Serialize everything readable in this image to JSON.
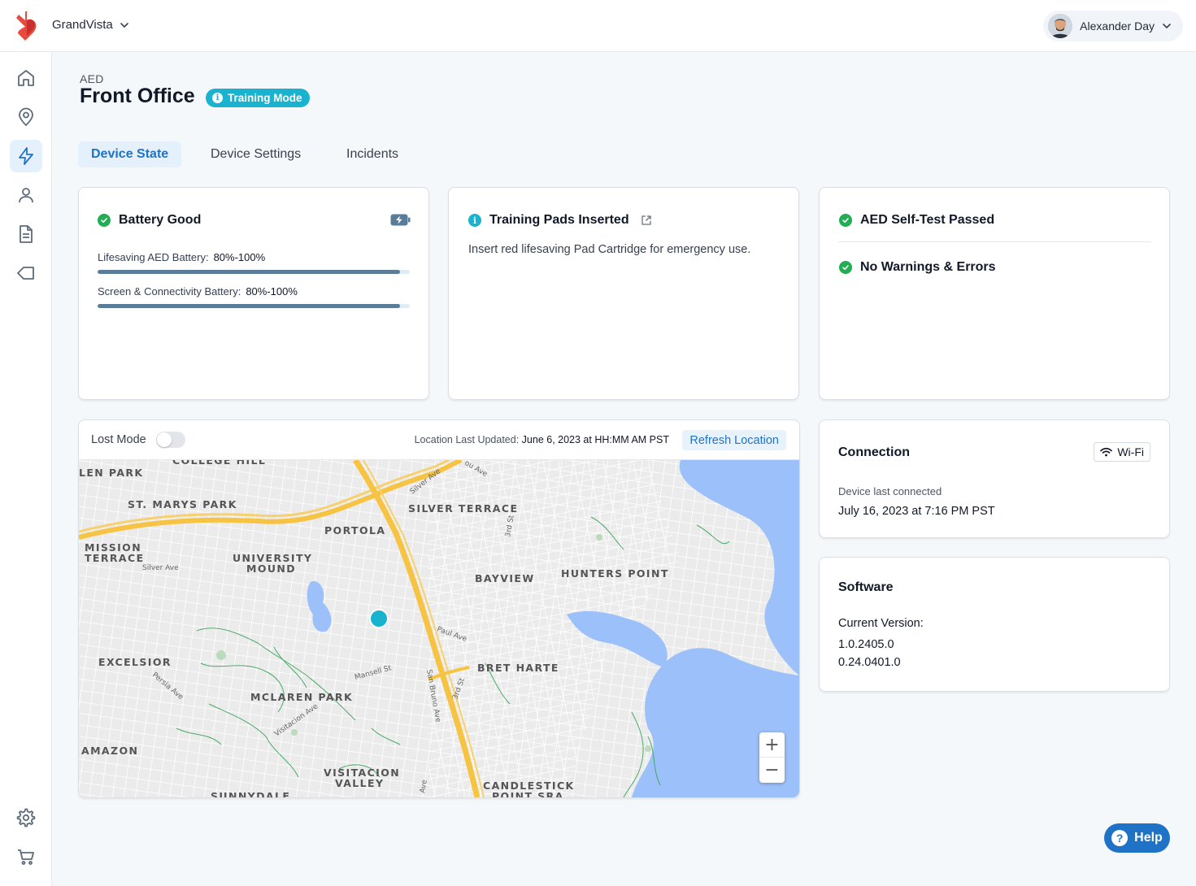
{
  "header": {
    "org_name": "GrandVista",
    "user_name": "Alexander Day"
  },
  "sidebar": {
    "items": [
      {
        "icon": "home-icon",
        "active": false
      },
      {
        "icon": "location-pin-icon",
        "active": false
      },
      {
        "icon": "lightning-icon",
        "active": true
      },
      {
        "icon": "user-icon",
        "active": false
      },
      {
        "icon": "document-icon",
        "active": false
      },
      {
        "icon": "tag-icon",
        "active": false
      }
    ],
    "bottom_items": [
      {
        "icon": "gear-icon"
      },
      {
        "icon": "cart-icon"
      }
    ]
  },
  "page": {
    "kicker": "AED",
    "title": "Front Office",
    "mode_badge": "Training Mode"
  },
  "tabs": [
    {
      "label": "Device State",
      "active": true
    },
    {
      "label": "Device Settings",
      "active": false
    },
    {
      "label": "Incidents",
      "active": false
    }
  ],
  "battery_card": {
    "status": "Battery Good",
    "rows": [
      {
        "label": "Lifesaving AED Battery:",
        "value": "80%-100%",
        "fill": 0.97
      },
      {
        "label": "Screen & Connectivity Battery:",
        "value": "80%-100%",
        "fill": 0.97
      }
    ]
  },
  "pads_card": {
    "status": "Training Pads Inserted",
    "description": "Insert red lifesaving Pad Cartridge for emergency use."
  },
  "selftest_card": {
    "status_1": "AED Self-Test Passed",
    "status_2": "No Warnings & Errors"
  },
  "map_card": {
    "lost_mode_label": "Lost Mode",
    "lost_mode_on": false,
    "updated_label": "Location Last Updated:",
    "updated_value": "June 6, 2023 at HH:MM AM PST",
    "refresh_label": "Refresh Location",
    "zoom_in": "+",
    "zoom_out": "−",
    "labels": {
      "glen_park": "LEN PARK",
      "college_hill": "COLLEGE HILL",
      "st_marys": "ST. MARYS PARK",
      "silver_terrace": "SILVER TERRACE",
      "portola": "PORTOLA",
      "mission_terrace_1": "MISSION",
      "mission_terrace_2": "TERRACE",
      "university_mound_1": "UNIVERSITY",
      "university_mound_2": "MOUND",
      "bayview": "BAYVIEW",
      "hunters_point": "HUNTERS POINT",
      "excelsior": "EXCELSIOR",
      "bret_harte": "BRET HARTE",
      "mclaren_park": "MCLAREN PARK",
      "amazon": "AMAZON",
      "visitacion_1": "VISITACION",
      "visitacion_2": "VALLEY",
      "candlestick_1": "CANDLESTICK",
      "candlestick_2": "POINT SRA",
      "sunnydale": "SUNNYDALE",
      "silver_ave": "Silver Ave",
      "silver_ave_2": "Silver Ave",
      "paul_ave": "Paul Ave",
      "mansell_st": "Mansell St",
      "persia_ave": "Persia Ave",
      "visitacion_ave": "Visitacion Ave",
      "san_bruno_ave": "San Bruno Ave",
      "third_st": "3rd St",
      "third_st_2": "3rd St",
      "ou_ave": "ou Ave",
      "ave": "Ave"
    }
  },
  "connection_card": {
    "title": "Connection",
    "type": "Wi-Fi",
    "last_label": "Device last connected",
    "last_value": "July 16, 2023 at 7:16 PM PST"
  },
  "software_card": {
    "title": "Software",
    "version_label": "Current Version:",
    "versions": [
      "1.0.2405.0",
      "0.24.0401.0"
    ]
  },
  "help": {
    "label": "Help",
    "icon": "?"
  },
  "colors": {
    "accent": "#1f73c7",
    "training": "#1ab3cf",
    "ok": "#22ad55",
    "battery_bar": "#5b7c99"
  }
}
